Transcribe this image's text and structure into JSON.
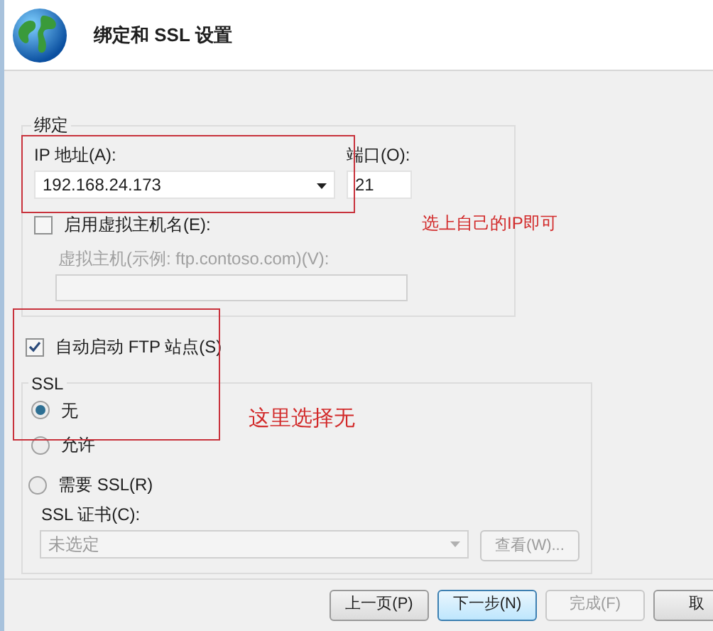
{
  "dialog": {
    "title": "绑定和 SSL 设置"
  },
  "binding": {
    "label": "绑定",
    "ip_label": "IP 地址(A):",
    "ip_value": "192.168.24.173",
    "port_label": "端口(O):",
    "port_value": "21",
    "virtual_host": {
      "label": "启用虚拟主机名(E):",
      "checked": false
    },
    "host_label": "虚拟主机(示例: ftp.contoso.com)(V):",
    "host_disabled": true
  },
  "autostart": {
    "label": "自动启动 FTP 站点(S)",
    "checked": true
  },
  "ssl": {
    "label": "SSL",
    "options": [
      {
        "label": "无",
        "selected": true
      },
      {
        "label": "允许",
        "selected": false
      },
      {
        "label": "需要 SSL(R)",
        "selected": false
      }
    ],
    "cert_label": "SSL 证书(C):",
    "cert_value": "未选定",
    "cert_disabled": true,
    "view_button": {
      "label": "查看(W)...",
      "disabled": true
    }
  },
  "annotations": [
    {
      "text": "选上自己的IP即可"
    },
    {
      "text": "这里选择无"
    }
  ],
  "buttons": [
    {
      "label": "上一页(P)",
      "disabled": false,
      "focused": false
    },
    {
      "label": "下一步(N)",
      "disabled": false,
      "focused": true
    },
    {
      "label": "完成(F)",
      "disabled": true,
      "focused": false
    },
    {
      "label": "取",
      "disabled": false,
      "focused": false
    }
  ]
}
